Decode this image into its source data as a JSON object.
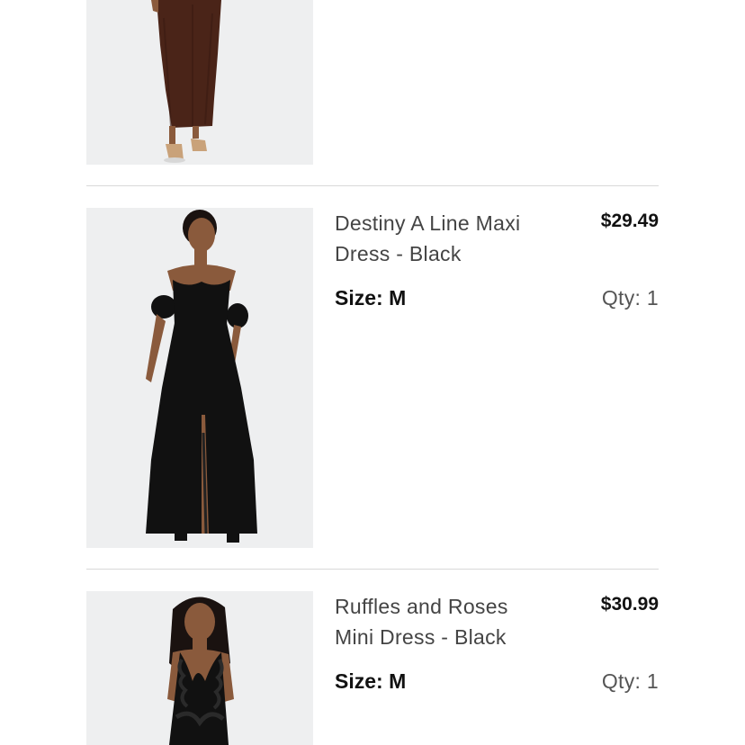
{
  "cart": {
    "items": [
      {
        "image_icon": "brown-maxi-dress-photo"
      },
      {
        "name_line1": "Destiny A Line Maxi",
        "name_line2": "Dress - Black",
        "price": "$29.49",
        "size": "Size: M",
        "qty": "Qty: 1",
        "image_icon": "black-a-line-maxi-dress-photo"
      },
      {
        "name_line1": "Ruffles and Roses",
        "name_line2": "Mini Dress - Black",
        "price": "$30.99",
        "size": "Size: M",
        "qty": "Qty: 1",
        "image_icon": "black-ruffle-mini-dress-photo"
      }
    ]
  },
  "colors": {
    "background": "#ffffff",
    "image_background": "#eeeff0",
    "divider": "#d9d9d9",
    "brown_dress": "#4a2418",
    "black_dress": "#111111",
    "skin": "#8a5a3c"
  }
}
